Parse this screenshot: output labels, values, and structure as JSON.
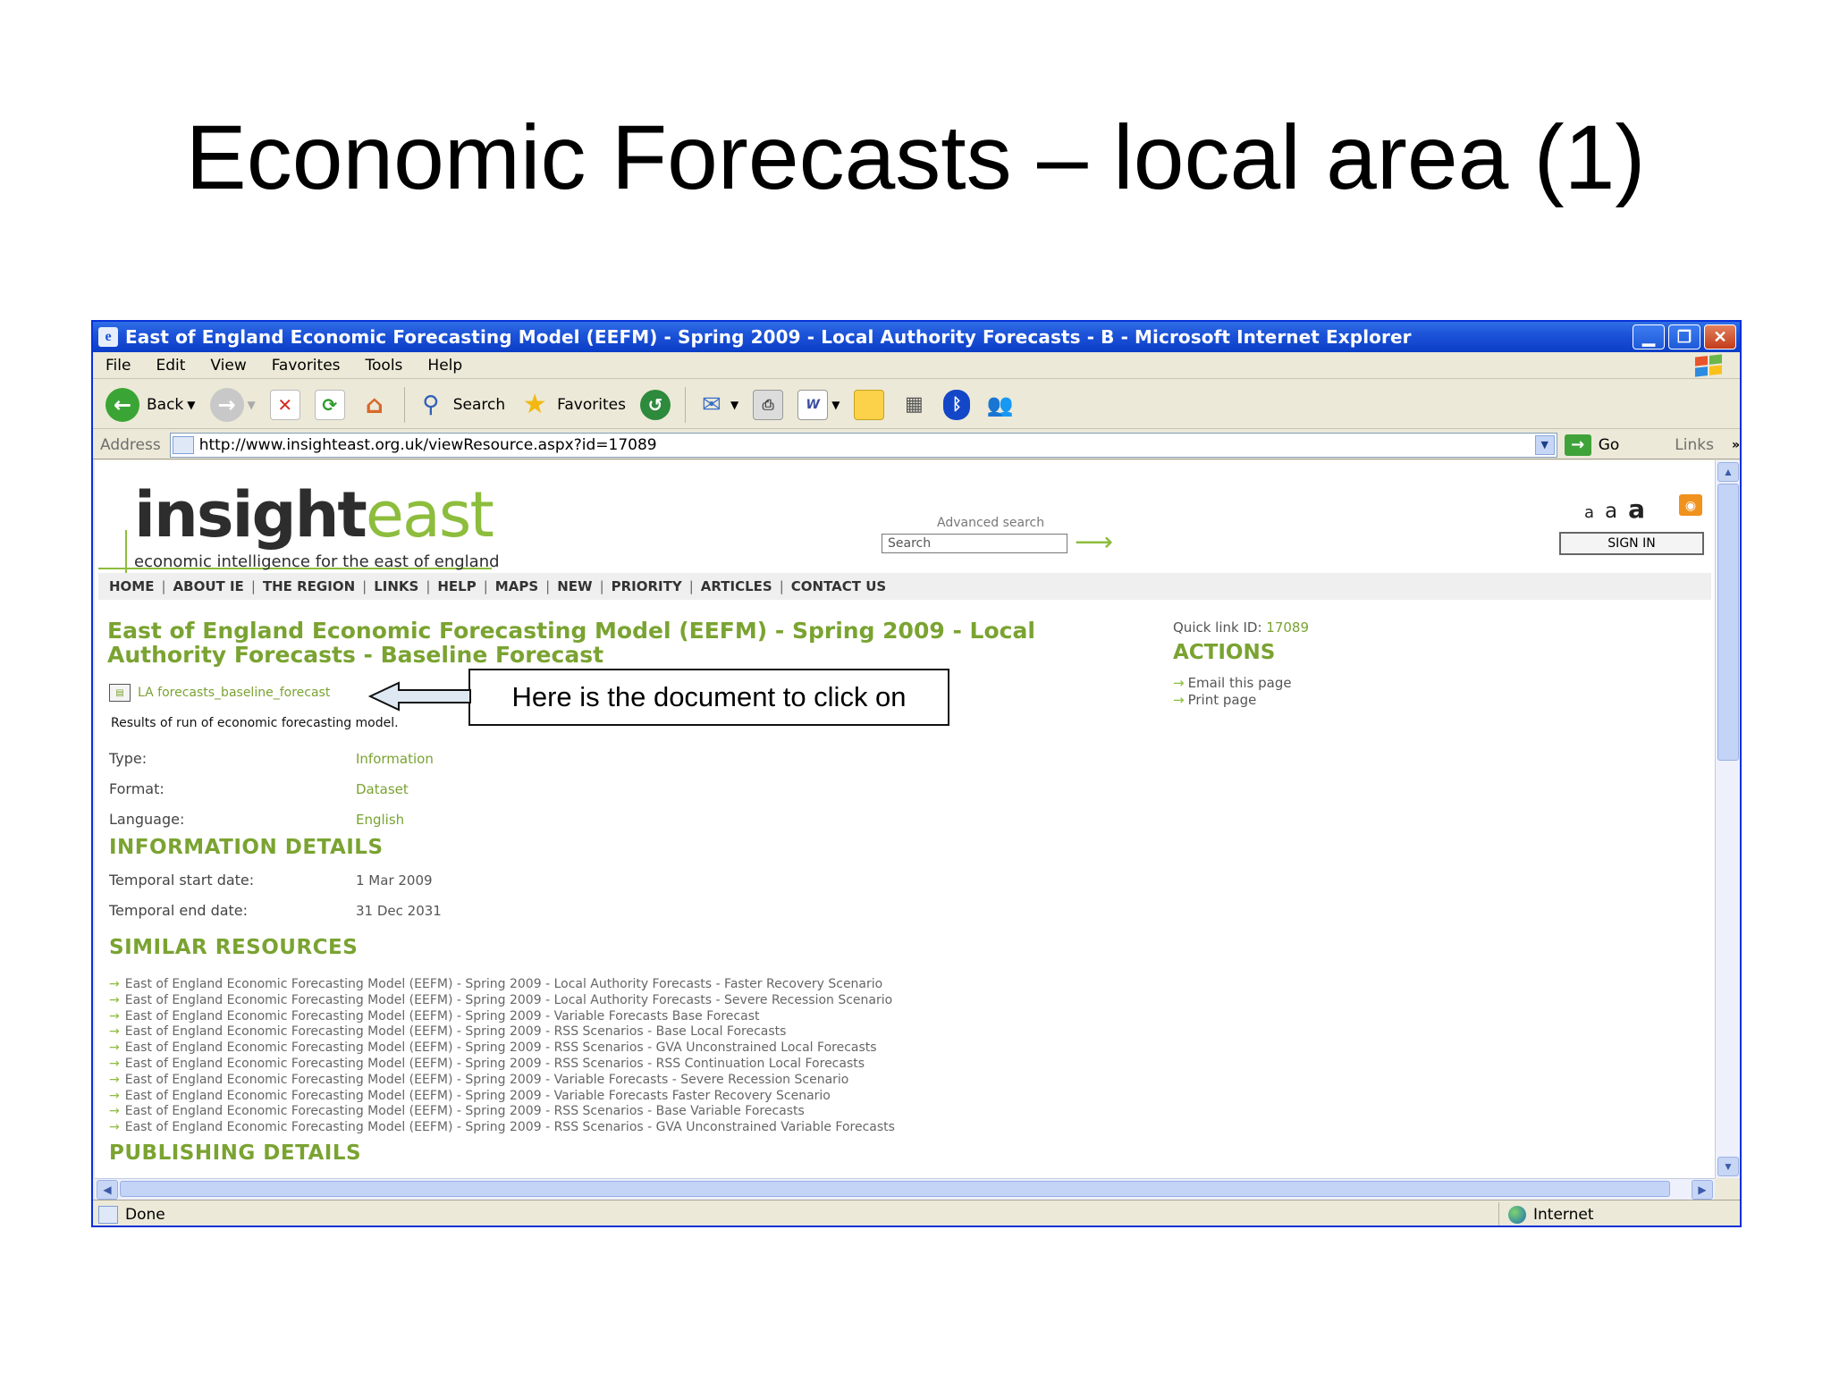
{
  "slide": {
    "title": "Economic Forecasts – local area (1)"
  },
  "window": {
    "title": "East of England Economic Forecasting Model (EEFM) - Spring 2009 - Local Authority Forecasts - B - Microsoft Internet Explorer",
    "menu": [
      "File",
      "Edit",
      "View",
      "Favorites",
      "Tools",
      "Help"
    ],
    "toolbar": {
      "back": "Back",
      "search": "Search",
      "favorites": "Favorites"
    },
    "address": {
      "label": "Address",
      "url": "http://www.insighteast.org.uk/viewResource.aspx?id=17089",
      "go": "Go",
      "links": "Links"
    },
    "status": {
      "text": "Done",
      "zone": "Internet"
    }
  },
  "site": {
    "logo_part1": "insight",
    "logo_part2": "east",
    "tagline": "economic intelligence for the east of england",
    "advanced_search": "Advanced search",
    "search_placeholder": "Search",
    "text_sizes": [
      "a",
      "a",
      "a"
    ],
    "sign_in": "SIGN IN",
    "nav": [
      "HOME",
      "ABOUT IE",
      "THE REGION",
      "LINKS",
      "HELP",
      "MAPS",
      "NEW",
      "PRIORITY",
      "ARTICLES",
      "CONTACT US"
    ]
  },
  "page": {
    "title_line1": "East of England Economic Forecasting Model (EEFM) - Spring 2009 - Local",
    "title_line2": "Authority Forecasts - Baseline Forecast",
    "doc_link": "LA forecasts_baseline_forecast",
    "callout": "Here is the document to click on",
    "description": "Results of run of economic forecasting model.",
    "meta": [
      {
        "label": "Type:",
        "value": "Information"
      },
      {
        "label": "Format:",
        "value": "Dataset"
      },
      {
        "label": "Language:",
        "value": "English"
      }
    ],
    "info_head": "INFORMATION DETAILS",
    "info": [
      {
        "label": "Temporal start date:",
        "value": "1 Mar 2009"
      },
      {
        "label": "Temporal end date:",
        "value": "31 Dec 2031"
      }
    ],
    "similar_head": "SIMILAR RESOURCES",
    "similar": [
      "East of England Economic Forecasting Model (EEFM) - Spring 2009 - Local Authority Forecasts - Faster Recovery Scenario",
      "East of England Economic Forecasting Model (EEFM) - Spring 2009 - Local Authority Forecasts - Severe Recession Scenario",
      "East of England Economic Forecasting Model (EEFM) - Spring 2009 - Variable Forecasts Base Forecast",
      "East of England Economic Forecasting Model (EEFM) - Spring 2009 - RSS Scenarios - Base Local Forecasts",
      "East of England Economic Forecasting Model (EEFM) - Spring 2009 - RSS Scenarios - GVA Unconstrained Local Forecasts",
      "East of England Economic Forecasting Model (EEFM) - Spring 2009 - RSS Scenarios - RSS Continuation Local Forecasts",
      "East of England Economic Forecasting Model (EEFM) - Spring 2009 - Variable Forecasts - Severe Recession Scenario",
      "East of England Economic Forecasting Model (EEFM) - Spring 2009 - Variable Forecasts Faster Recovery Scenario",
      "East of England Economic Forecasting Model (EEFM) - Spring 2009 - RSS Scenarios - Base Variable Forecasts",
      "East of England Economic Forecasting Model (EEFM) - Spring 2009 - RSS Scenarios - GVA Unconstrained Variable Forecasts"
    ],
    "publishing_head": "PUBLISHING DETAILS",
    "quick_link_label": "Quick link ID:",
    "quick_link_id": "17089",
    "actions_head": "ACTIONS",
    "actions": [
      "Email this page",
      "Print page"
    ]
  },
  "colors": {
    "accent_green": "#7aa331",
    "titlebar_blue": "#0a3dc7"
  }
}
